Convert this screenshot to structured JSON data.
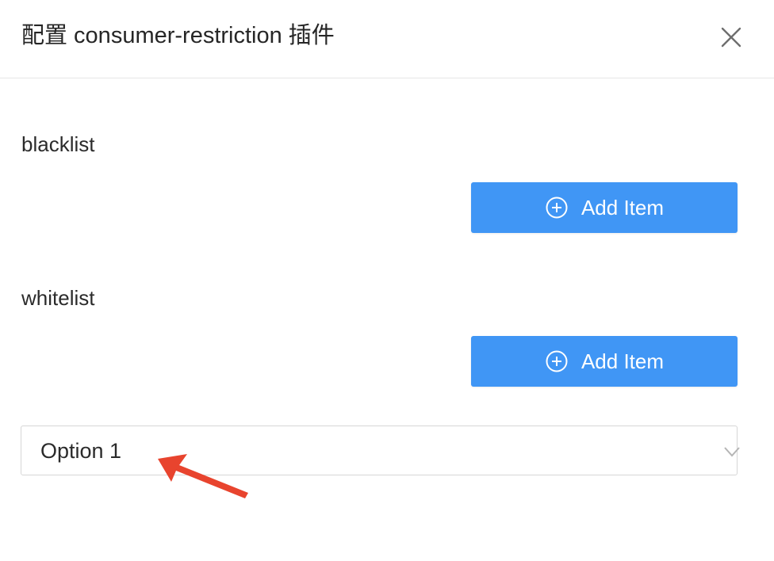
{
  "dialog": {
    "title": "配置 consumer-restriction 插件",
    "close_icon": "close-icon"
  },
  "fields": {
    "blacklist": {
      "label": "blacklist",
      "add_button_label": "Add Item",
      "add_icon": "plus-circle-icon"
    },
    "whitelist": {
      "label": "whitelist",
      "add_button_label": "Add Item",
      "add_icon": "plus-circle-icon"
    }
  },
  "type_select": {
    "value": "Option 1",
    "icon": "chevron-down-icon"
  },
  "annotation": {
    "icon": "red-arrow-annotation",
    "color": "#e8442e"
  },
  "colors": {
    "primary": "#4096f5",
    "border": "#d6d6d6",
    "divider": "#e6e6e6"
  }
}
